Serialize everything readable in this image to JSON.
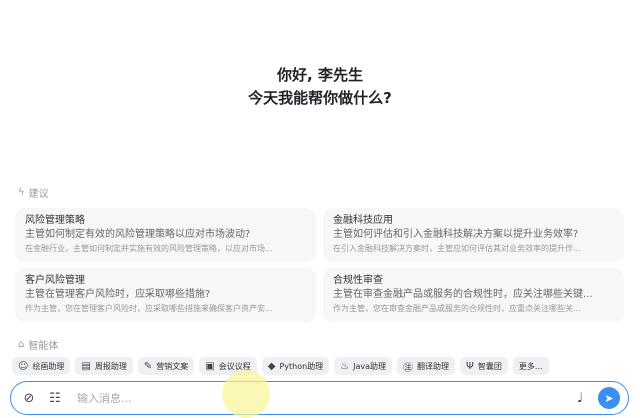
{
  "greeting": {
    "line1": "你好, 李先生",
    "line2": "今天我能帮你做什么?"
  },
  "suggestions": {
    "label": "建议",
    "items": [
      {
        "title": "风险管理策略",
        "question": "主管如何制定有效的风险管理策略以应对市场波动?",
        "desc": "在金融行业，主管如何制定并实施有效的风险管理策略，以应对市场..."
      },
      {
        "title": "金融科技应用",
        "question": "主管如何评估和引入金融科技解决方案以提升业务效率?",
        "desc": "在引入金融科技解决方案时，主管应如何评估其对业务效率的提升作..."
      },
      {
        "title": "客户风险管理",
        "question": "主管在管理客户风险时，应采取哪些措施?",
        "desc": "作为主管，您在管理客户风险时，应采取哪些措施来确保客户资产安..."
      },
      {
        "title": "合规性审查",
        "question": "主管在审查金融产品或服务的合规性时，应关注哪些关键...",
        "desc": "作为主管，您在审查金融产品或服务的合规性时，应重点关注哪些关..."
      }
    ]
  },
  "agents": {
    "label": "智能体",
    "items": [
      {
        "label": "绘画助理",
        "icon": "palette-icon"
      },
      {
        "label": "周报助理",
        "icon": "report-icon"
      },
      {
        "label": "营销文案",
        "icon": "edit-icon"
      },
      {
        "label": "会议议程",
        "icon": "agenda-icon"
      },
      {
        "label": "Python助理",
        "icon": "python-icon"
      },
      {
        "label": "Java助理",
        "icon": "java-icon"
      },
      {
        "label": "翻译助理",
        "icon": "translate-icon"
      },
      {
        "label": "智囊团",
        "icon": "team-icon"
      },
      {
        "label": "更多..."
      }
    ]
  },
  "input": {
    "placeholder": "输入消息..."
  },
  "colors": {
    "accent": "#3b8ff0"
  }
}
